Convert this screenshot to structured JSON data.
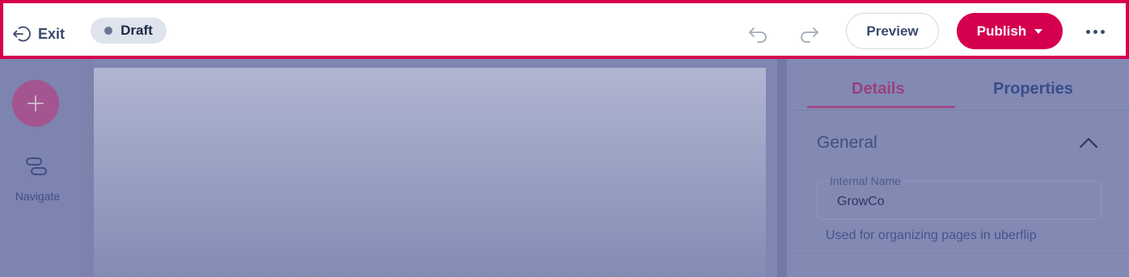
{
  "toolbar": {
    "exit_label": "Exit",
    "status_label": "Draft",
    "preview_label": "Preview",
    "publish_label": "Publish"
  },
  "left_rail": {
    "navigate_label": "Navigate"
  },
  "panel": {
    "tabs": [
      {
        "label": "Details",
        "active": true
      },
      {
        "label": "Properties",
        "active": false
      }
    ],
    "section_title": "General",
    "field": {
      "label": "Internal Name",
      "value": "GrowCo",
      "help": "Used for organizing pages in uberflip"
    }
  },
  "colors": {
    "accent": "#d4004f",
    "overlay": "#7f86b3"
  },
  "icons": [
    "exit-icon",
    "undo-icon",
    "redo-icon",
    "caret-down-icon",
    "more-icon",
    "plus-icon",
    "navigate-icon",
    "chevron-up-icon"
  ]
}
